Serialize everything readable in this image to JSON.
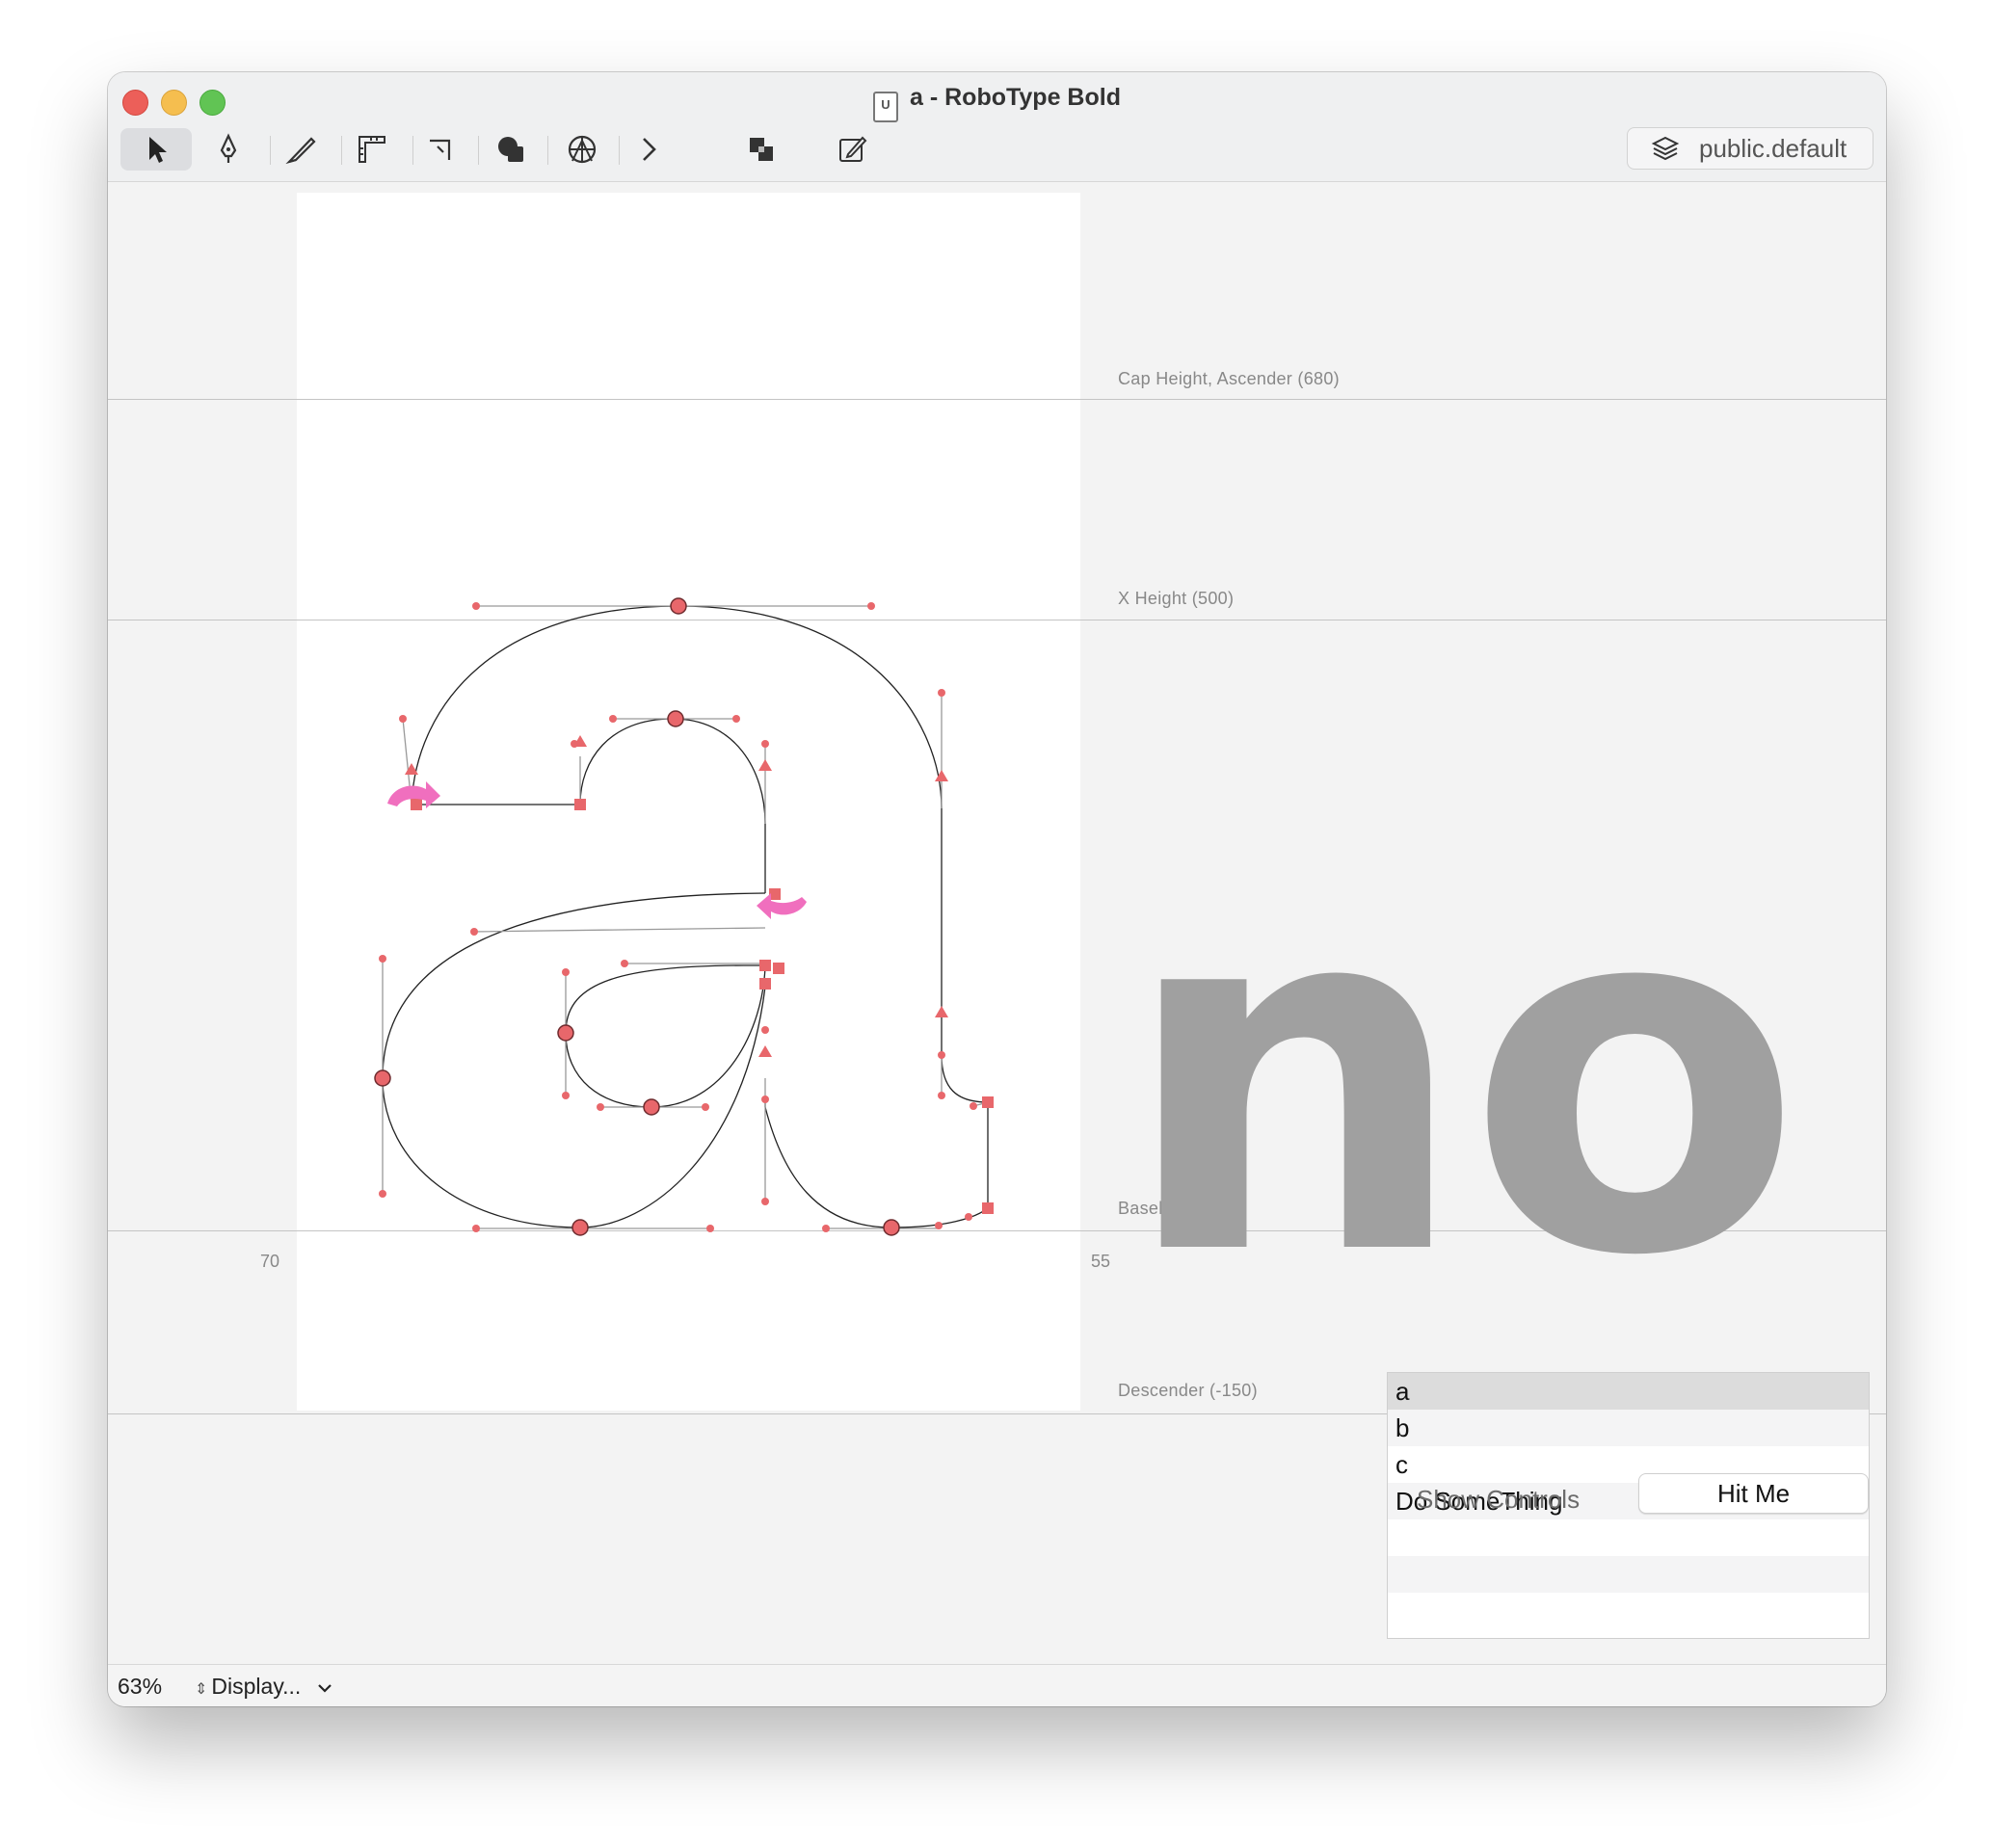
{
  "window": {
    "title": "a - RoboType Bold",
    "doc_icon_text": "U"
  },
  "toolbar": {
    "tools": [
      {
        "name": "arrow-tool",
        "icon": "cursor-arrow",
        "active": true
      },
      {
        "name": "pen-tool",
        "icon": "pen-nib"
      },
      {
        "name": "knife-tool",
        "icon": "knife"
      },
      {
        "name": "measure-tool",
        "icon": "ruler"
      },
      {
        "name": "corner-tool",
        "icon": "corner"
      },
      {
        "name": "shapes-tool",
        "icon": "shapes"
      },
      {
        "name": "anchor-tool",
        "icon": "anchor-circle"
      },
      {
        "name": "more-tools",
        "icon": "chevron-right"
      },
      {
        "name": "overlap-tool",
        "icon": "overlap-squares"
      },
      {
        "name": "transform-tool",
        "icon": "box-pencil"
      }
    ],
    "layer_label": "public.default"
  },
  "canvas": {
    "metrics": {
      "cap_height": "Cap Height, Ascender (680)",
      "x_height": "X Height (500)",
      "baseline": "Baseline",
      "descender": "Descender (-150)"
    },
    "left_sidebearing": "70",
    "right_sidebearing": "55",
    "preview_text": "no",
    "glyph": "a",
    "point_color": "#e8676b",
    "start_point_color": "#f06fbe"
  },
  "list": {
    "items": [
      "a",
      "b",
      "c",
      "Do SomeThing",
      "",
      "",
      ""
    ],
    "selected_index": 0
  },
  "controls": {
    "show_controls_label": "Show Controls",
    "hit_me_label": "Hit Me"
  },
  "status": {
    "zoom": "63%",
    "display_label": "Display..."
  }
}
